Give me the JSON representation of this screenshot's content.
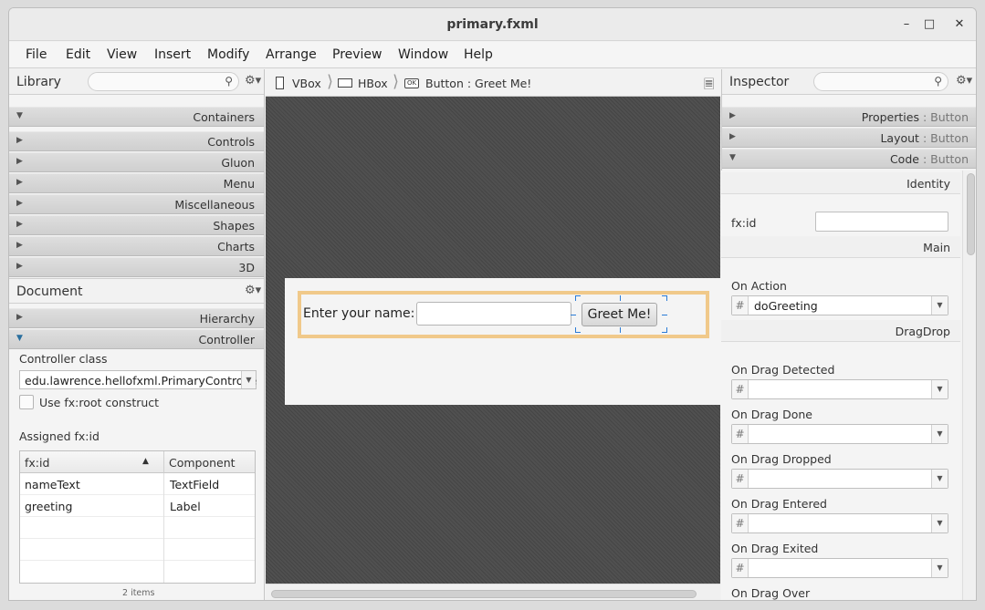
{
  "window": {
    "title": "primary.fxml"
  },
  "menu": [
    "File",
    "Edit",
    "View",
    "Insert",
    "Modify",
    "Arrange",
    "Preview",
    "Window",
    "Help"
  ],
  "library": {
    "title": "Library",
    "sections": [
      "Containers",
      "Controls",
      "Gluon",
      "Menu",
      "Miscellaneous",
      "Shapes",
      "Charts",
      "3D"
    ]
  },
  "document": {
    "title": "Document",
    "sections": [
      "Hierarchy",
      "Controller"
    ],
    "controller_class_label": "Controller class",
    "controller_class_value": "edu.lawrence.hellofxml.PrimaryControlle",
    "root_construct_label": "Use fx:root construct",
    "assigned_label": "Assigned fx:id",
    "table": {
      "headers": [
        "fx:id",
        "Component"
      ],
      "rows": [
        {
          "id": "nameText",
          "component": "TextField"
        },
        {
          "id": "greeting",
          "component": "Label"
        }
      ],
      "footer": "2 items"
    }
  },
  "breadcrumb": [
    "VBox",
    "HBox",
    "Button : Greet Me!"
  ],
  "canvas": {
    "label": "Enter your name:",
    "button": "Greet Me!"
  },
  "inspector": {
    "title": "Inspector",
    "sections": [
      {
        "name": "Properties",
        "sub": " : Button"
      },
      {
        "name": "Layout",
        "sub": " : Button"
      },
      {
        "name": "Code",
        "sub": " : Button"
      }
    ],
    "identity_header": "Identity",
    "fxid_label": "fx:id",
    "main_header": "Main",
    "on_action_label": "On Action",
    "on_action_value": "doGreeting",
    "dragdrop_header": "DragDrop",
    "drag_labels": [
      "On Drag Detected",
      "On Drag Done",
      "On Drag Dropped",
      "On Drag Entered",
      "On Drag Exited",
      "On Drag Over"
    ],
    "hash": "#"
  }
}
